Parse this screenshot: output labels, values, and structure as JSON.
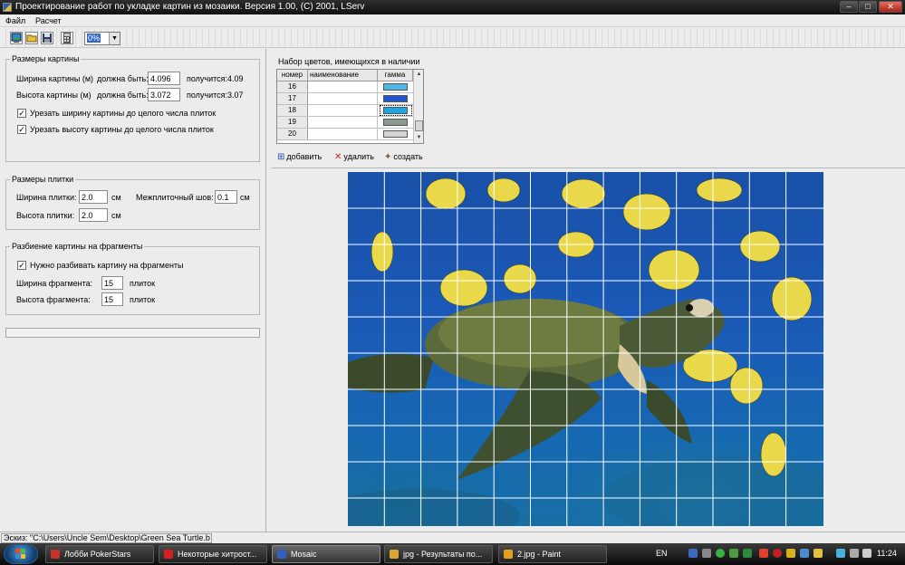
{
  "window": {
    "title": "Проектирование работ по укладке картин из мозаики. Версия 1.00, (С) 2001, LServ",
    "min": "–",
    "max": "□",
    "close": "✕"
  },
  "menu": [
    "Файл",
    "Расчет"
  ],
  "toolbar": {
    "zoom_value": "0%",
    "zoom_arrow": "▼"
  },
  "picture_size": {
    "title": "Размеры картины",
    "width_label": "Ширина картины (м)",
    "height_label": "Высота картины (м)",
    "should_be_label": "должна быть:",
    "result_label": "получится:",
    "width_value": "4.096",
    "height_value": "3.072",
    "width_result": "4.09",
    "height_result": "3.07",
    "trim_width_label": "Урезать ширину картины до целого числа плиток",
    "trim_height_label": "Урезать высоту картины до целого числа плиток",
    "trim_width_checked": true,
    "trim_height_checked": true
  },
  "tile_size": {
    "title": "Размеры плитки",
    "width_label": "Ширина плитки:",
    "height_label": "Высота плитки:",
    "width_value": "2.0",
    "height_value": "2.0",
    "unit": "см",
    "seam_label": "Межплиточный шов:",
    "seam_value": "0.1"
  },
  "fragments": {
    "title": "Разбиение картины на фрагменты",
    "need_split_label": "Нужно разбивать картину на фрагменты",
    "need_split_checked": true,
    "width_label": "Ширина фрагмента:",
    "height_label": "Высота фрагмента:",
    "width_value": "15",
    "height_value": "15",
    "unit": "плиток"
  },
  "color_set": {
    "caption": "Набор цветов, имеющихся в наличии",
    "columns": [
      "номер",
      "наименование",
      "гамма"
    ],
    "rows": [
      {
        "num": "16",
        "name": "",
        "color": "#4db8e8"
      },
      {
        "num": "17",
        "name": "",
        "color": "#2255cc"
      },
      {
        "num": "18",
        "name": "",
        "color": "#19a6e6"
      },
      {
        "num": "19",
        "name": "",
        "color": "#8a9a8c"
      },
      {
        "num": "20",
        "name": "",
        "color": "#d4d4d4"
      }
    ],
    "selected_row": 2,
    "add_label": "добавить",
    "delete_label": "удалить",
    "create_label": "создать"
  },
  "image": {
    "grid_cols": 13,
    "grid_rows": 10,
    "grid_color": "#ffffff"
  },
  "status": {
    "sketch": "Эскиз: \"C:\\Users\\Uncle Sem\\Desktop\\Green Sea Turtle.b"
  },
  "taskbar": {
    "tasks": [
      {
        "label": "Лобби PokerStars",
        "color": "#c8302a"
      },
      {
        "label": "Некоторые хитрост...",
        "color": "#d42020"
      },
      {
        "label": "Mosaic",
        "color": "#3060c0"
      },
      {
        "label": "jpg - Результаты по...",
        "color": "#d8a830"
      },
      {
        "label": "2.jpg - Paint",
        "color": "#e0a020"
      }
    ],
    "language": "EN",
    "clock": "11:24"
  }
}
